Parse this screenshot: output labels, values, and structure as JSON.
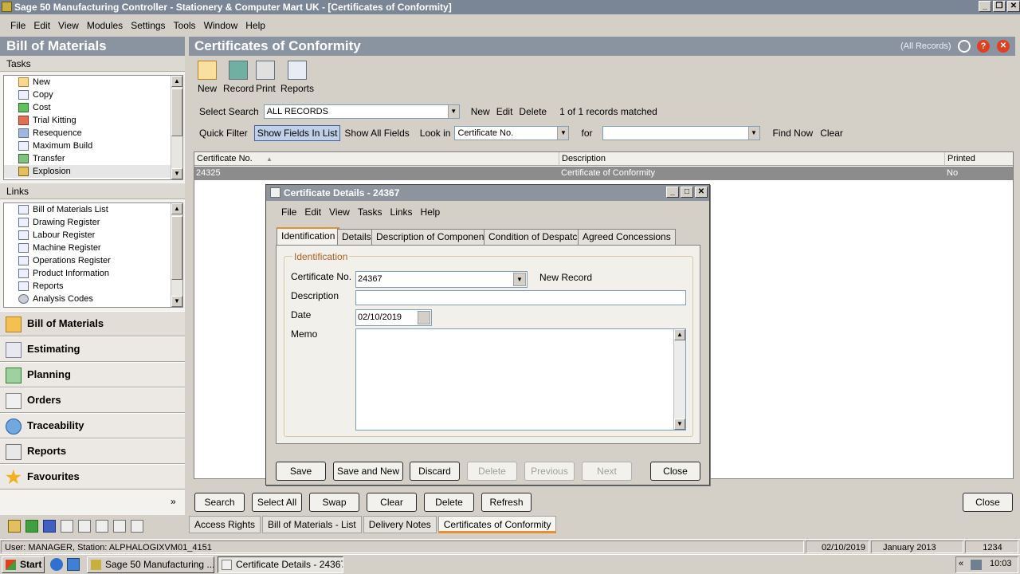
{
  "window": {
    "title": "Sage 50 Manufacturing Controller - Stationery & Computer Mart UK - [Certificates of Conformity]"
  },
  "menubar": [
    "File",
    "Edit",
    "View",
    "Modules",
    "Settings",
    "Tools",
    "Window",
    "Help"
  ],
  "left": {
    "title": "Bill of Materials",
    "tasks_label": "Tasks",
    "tasks": [
      "New",
      "Copy",
      "Cost",
      "Trial Kitting",
      "Resequence",
      "Maximum Build",
      "Transfer",
      "Explosion"
    ],
    "links_label": "Links",
    "links": [
      "Bill of Materials List",
      "Drawing Register",
      "Labour Register",
      "Machine Register",
      "Operations Register",
      "Product Information",
      "Reports",
      "Analysis Codes"
    ],
    "nav": [
      "Bill of Materials",
      "Estimating",
      "Planning",
      "Orders",
      "Traceability",
      "Reports",
      "Favourites"
    ],
    "collapse_glyph": "»"
  },
  "main": {
    "title": "Certificates of Conformity",
    "all_records": "(All Records)",
    "toolbar": [
      "New",
      "Record",
      "Print",
      "Reports"
    ],
    "select_search_label": "Select Search",
    "select_search_value": "ALL RECORDS",
    "search_actions": [
      "New",
      "Edit",
      "Delete"
    ],
    "matched": "1 of 1 records matched",
    "quick_filter": "Quick Filter",
    "show_fields": "Show Fields In List",
    "show_all": "Show All Fields",
    "look_in_label": "Look in",
    "look_in_value": "Certificate No.",
    "for_label": "for",
    "find_now": "Find Now",
    "clear": "Clear",
    "columns": [
      "Certificate No.",
      "Description",
      "Printed"
    ],
    "rows": [
      {
        "cert": "24325",
        "desc": "Certificate of Conformity",
        "printed": "No"
      }
    ],
    "buttons": [
      "Search",
      "Select All",
      "Swap",
      "Clear",
      "Delete",
      "Refresh"
    ],
    "close": "Close"
  },
  "bottom_tabs": [
    "Access Rights",
    "Bill of Materials - List",
    "Delivery Notes",
    "Certificates of Conformity"
  ],
  "status": {
    "user": "User: MANAGER, Station: ALPHALOGIXVM01_4151",
    "date": "02/10/2019",
    "period": "January 2013",
    "code": "1234"
  },
  "taskbar": {
    "start": "Start",
    "tasks": [
      "Sage 50 Manufacturing ...",
      "Certificate Details - 24367"
    ],
    "time": "10:03",
    "chevron": "«"
  },
  "dialog": {
    "title": "Certificate Details - 24367",
    "menu": [
      "File",
      "Edit",
      "View",
      "Tasks",
      "Links",
      "Help"
    ],
    "tabs": [
      "Identification",
      "Details",
      "Description of Components",
      "Condition of Despatch",
      "Agreed Concessions"
    ],
    "group": "Identification",
    "cert_label": "Certificate No.",
    "cert_value": "24367",
    "new_record": "New Record",
    "desc_label": "Description",
    "desc_value": "",
    "date_label": "Date",
    "date_value": "02/10/2019",
    "memo_label": "Memo",
    "buttons": [
      "Save",
      "Save and New",
      "Discard",
      "Delete",
      "Previous",
      "Next",
      "Close"
    ]
  }
}
